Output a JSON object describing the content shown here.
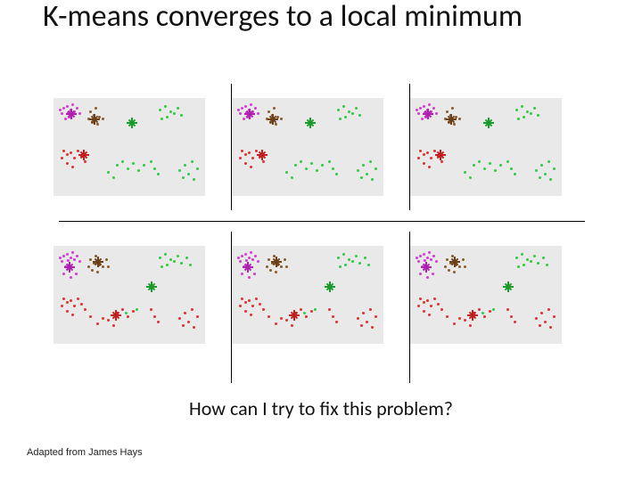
{
  "title": "K-means converges to a local minimum",
  "question": "How can I try to fix this problem?",
  "credit": "Adapted from James Hays",
  "colors": {
    "magenta": "#d63bd6",
    "green": "#2ecc40",
    "red": "#e03030",
    "brown": "#8a5a2a",
    "panel_bg": "#e9e9e9"
  },
  "chart_data": [
    {
      "type": "scatter",
      "row": 0,
      "col": 0,
      "note": "top row — one bad local minimum (same clustering repeated 3×)",
      "clusters": [
        {
          "color": "magenta",
          "centroid": [
            20,
            18
          ],
          "points": [
            [
              10,
              10
            ],
            [
              14,
              8
            ],
            [
              18,
              12
            ],
            [
              8,
              16
            ],
            [
              22,
              14
            ],
            [
              16,
              20
            ],
            [
              12,
              22
            ],
            [
              25,
              10
            ],
            [
              6,
              12
            ],
            [
              20,
              6
            ],
            [
              28,
              16
            ],
            [
              15,
              15
            ]
          ]
        },
        {
          "color": "brown",
          "centroid": [
            46,
            24
          ],
          "points": [
            [
              40,
              14
            ],
            [
              44,
              18
            ],
            [
              50,
              20
            ],
            [
              48,
              28
            ],
            [
              42,
              26
            ],
            [
              54,
              22
            ],
            [
              38,
              22
            ],
            [
              46,
              10
            ]
          ]
        },
        {
          "color": "green",
          "centroid": [
            88,
            28
          ],
          "points": [
            [
              118,
              12
            ],
            [
              124,
              8
            ],
            [
              130,
              14
            ],
            [
              126,
              20
            ],
            [
              134,
              16
            ],
            [
              120,
              22
            ],
            [
              138,
              10
            ],
            [
              142,
              18
            ],
            [
              70,
              74
            ],
            [
              76,
              70
            ],
            [
              82,
              78
            ],
            [
              88,
              72
            ],
            [
              94,
              80
            ],
            [
              100,
              74
            ],
            [
              60,
              82
            ],
            [
              66,
              88
            ],
            [
              108,
              70
            ],
            [
              112,
              78
            ],
            [
              116,
              84
            ],
            [
              140,
              80
            ],
            [
              146,
              74
            ],
            [
              150,
              84
            ],
            [
              154,
              70
            ],
            [
              160,
              78
            ],
            [
              144,
              88
            ],
            [
              156,
              90
            ]
          ]
        },
        {
          "color": "red",
          "centroid": [
            34,
            64
          ],
          "points": [
            [
              10,
              58
            ],
            [
              14,
              62
            ],
            [
              8,
              66
            ],
            [
              18,
              60
            ],
            [
              22,
              66
            ],
            [
              26,
              58
            ],
            [
              30,
              64
            ],
            [
              34,
              70
            ],
            [
              14,
              72
            ],
            [
              20,
              76
            ]
          ]
        }
      ]
    },
    {
      "type": "scatter",
      "row": 0,
      "col": 1,
      "same_as": [
        0,
        0
      ]
    },
    {
      "type": "scatter",
      "row": 0,
      "col": 2,
      "same_as": [
        0,
        0
      ]
    },
    {
      "type": "scatter",
      "row": 1,
      "col": 0,
      "note": "bottom row — different bad local minimum (same clustering repeated 3×)",
      "clusters": [
        {
          "color": "magenta",
          "centroid": [
            18,
            24
          ],
          "points": [
            [
              10,
              10
            ],
            [
              14,
              8
            ],
            [
              18,
              12
            ],
            [
              8,
              16
            ],
            [
              22,
              14
            ],
            [
              16,
              20
            ],
            [
              12,
              22
            ],
            [
              25,
              10
            ],
            [
              6,
              12
            ],
            [
              20,
              6
            ],
            [
              28,
              16
            ],
            [
              15,
              15
            ],
            [
              10,
              30
            ],
            [
              18,
              34
            ],
            [
              24,
              30
            ]
          ]
        },
        {
          "color": "brown",
          "centroid": [
            50,
            18
          ],
          "points": [
            [
              40,
              14
            ],
            [
              44,
              18
            ],
            [
              50,
              20
            ],
            [
              48,
              28
            ],
            [
              42,
              26
            ],
            [
              54,
              22
            ],
            [
              38,
              22
            ],
            [
              46,
              10
            ],
            [
              58,
              14
            ],
            [
              60,
              22
            ]
          ]
        },
        {
          "color": "green",
          "centroid": [
            110,
            46
          ],
          "points": [
            [
              118,
              12
            ],
            [
              124,
              8
            ],
            [
              130,
              14
            ],
            [
              126,
              20
            ],
            [
              134,
              16
            ],
            [
              120,
              22
            ],
            [
              138,
              10
            ],
            [
              142,
              18
            ],
            [
              148,
              12
            ],
            [
              152,
              20
            ],
            [
              80,
              74
            ],
            [
              92,
              70
            ]
          ]
        },
        {
          "color": "red",
          "centroid": [
            70,
            78
          ],
          "points": [
            [
              10,
              58
            ],
            [
              14,
              62
            ],
            [
              8,
              66
            ],
            [
              18,
              60
            ],
            [
              22,
              66
            ],
            [
              26,
              58
            ],
            [
              30,
              64
            ],
            [
              34,
              70
            ],
            [
              14,
              72
            ],
            [
              20,
              76
            ],
            [
              70,
              74
            ],
            [
              76,
              70
            ],
            [
              82,
              78
            ],
            [
              88,
              72
            ],
            [
              60,
              82
            ],
            [
              66,
              88
            ],
            [
              108,
              70
            ],
            [
              112,
              78
            ],
            [
              116,
              84
            ],
            [
              140,
              80
            ],
            [
              146,
              74
            ],
            [
              150,
              84
            ],
            [
              154,
              70
            ],
            [
              160,
              78
            ],
            [
              144,
              88
            ],
            [
              156,
              90
            ],
            [
              48,
              86
            ],
            [
              54,
              80
            ],
            [
              40,
              78
            ]
          ]
        }
      ]
    },
    {
      "type": "scatter",
      "row": 1,
      "col": 1,
      "same_as": [
        1,
        0
      ]
    },
    {
      "type": "scatter",
      "row": 1,
      "col": 2,
      "same_as": [
        1,
        0
      ]
    }
  ]
}
